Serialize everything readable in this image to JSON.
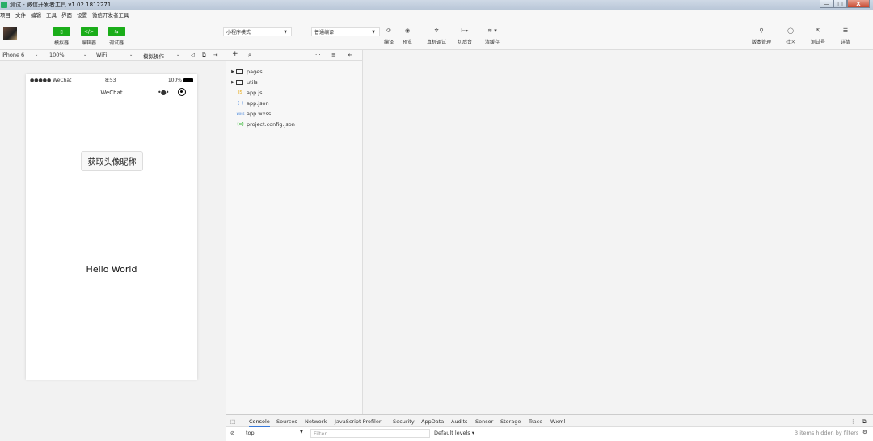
{
  "window": {
    "title": "测试 - 微信开发者工具 v1.02.1812271",
    "controls": [
      "—",
      "□",
      "X"
    ]
  },
  "menu": [
    "项目",
    "文件",
    "编辑",
    "工具",
    "界面",
    "设置",
    "微信开发者工具"
  ],
  "toolbar": {
    "modes": [
      {
        "label": "模拟器",
        "icon": "phone-icon",
        "glyph": "▯"
      },
      {
        "label": "编辑器",
        "icon": "code-icon",
        "glyph": "</>"
      },
      {
        "label": "调试器",
        "icon": "debug-icon",
        "glyph": "⇆"
      }
    ],
    "mode_select": "小程序模式",
    "compile_select": "普通编译",
    "tools": [
      {
        "label": "编译",
        "glyph": "⟳"
      },
      {
        "label": "预览",
        "glyph": "◉"
      },
      {
        "label": "真机调试",
        "glyph": "✲"
      },
      {
        "label": "切后台",
        "glyph": "⊢▸"
      },
      {
        "label": "清缓存",
        "glyph": "≋ ▾"
      }
    ],
    "right_tools": [
      {
        "label": "版本管理",
        "glyph": "⚲"
      },
      {
        "label": "社区",
        "glyph": "◯"
      },
      {
        "label": "测试号",
        "glyph": "⇱"
      },
      {
        "label": "详情",
        "glyph": "☰"
      }
    ]
  },
  "simulator": {
    "device": "iPhone 6",
    "zoom": "100%",
    "network": "WiFi",
    "action": "模拟操作",
    "status": {
      "signal": "●●●●● WeChat",
      "time": "8:53",
      "battery": "100%"
    },
    "nav_title": "WeChat",
    "button_label": "获取头像昵称",
    "text": "Hello World"
  },
  "filetree": {
    "items": [
      {
        "name": "pages",
        "type": "folder"
      },
      {
        "name": "utils",
        "type": "folder"
      },
      {
        "name": "app.js",
        "type": "js",
        "icon": "JS",
        "color": "#e5a100"
      },
      {
        "name": "app.json",
        "type": "json",
        "icon": "{ }",
        "color": "#3d7fd9"
      },
      {
        "name": "app.wxss",
        "type": "wxss",
        "icon": "wxss",
        "color": "#3d7fd9"
      },
      {
        "name": "project.config.json",
        "type": "config",
        "icon": "{o}",
        "color": "#1aad19"
      }
    ]
  },
  "devtools": {
    "tabs": [
      "Console",
      "Sources",
      "Network",
      "JavaScript Profiler",
      "Security",
      "AppData",
      "Audits",
      "Sensor",
      "Storage",
      "Trace",
      "Wxml"
    ],
    "active_tab": "Console",
    "context": "top",
    "filter_placeholder": "Filter",
    "levels": "Default levels ▾",
    "hidden_info": "3 items hidden by filters"
  },
  "colors": {
    "accent": "#1aad19",
    "tab_underline": "#3879d9"
  }
}
